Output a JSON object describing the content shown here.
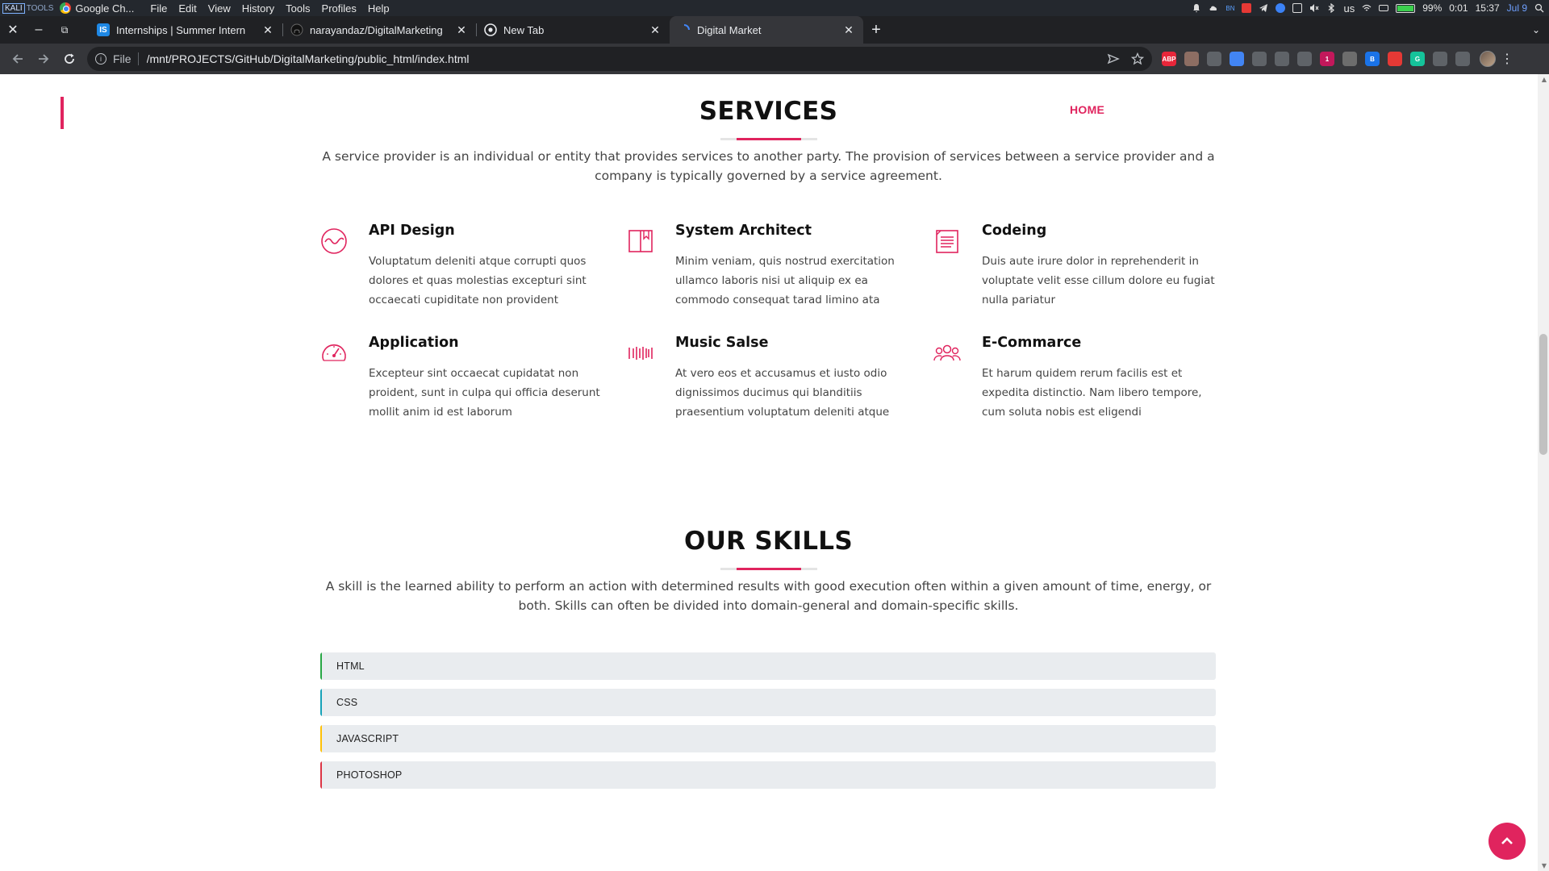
{
  "system_panel": {
    "kali_box": "KALI",
    "kali_tools": "TOOLS",
    "app_name": "Google Ch...",
    "menu": [
      "File",
      "Edit",
      "View",
      "History",
      "Tools",
      "Profiles",
      "Help"
    ],
    "tray_locale": "us",
    "tray_bn": "BN",
    "battery_text": "99%",
    "battery_level": 0.99,
    "uptime": "0:01",
    "clock": "15:37",
    "date": "Jul 9"
  },
  "tabs": [
    {
      "label": "Internships | Summer Intern",
      "favicon": "IS",
      "favicon_color": "#1e88e5",
      "active": false
    },
    {
      "label": "narayandaz/DigitalMarketing",
      "favicon": "github-icon",
      "favicon_color": "#24292e",
      "active": false
    },
    {
      "label": "New Tab",
      "favicon": "chrome-icon",
      "favicon_color": "#5f6368",
      "active": false
    },
    {
      "label": "Digital Market",
      "favicon": "loading-icon",
      "favicon_color": "#4285f4",
      "active": true
    }
  ],
  "toolbar": {
    "scheme": "File",
    "url": "/mnt/PROJECTS/GitHub/DigitalMarketing/public_html/index.html"
  },
  "extensions": [
    {
      "name": "adblock-plus-icon",
      "text": "ABP",
      "color": "#e8263a"
    },
    {
      "name": "extension-owl-icon",
      "text": "",
      "color": "#8d6e63"
    },
    {
      "name": "extension-print-icon",
      "text": "",
      "color": "#5f6368"
    },
    {
      "name": "google-translate-icon",
      "text": "",
      "color": "#4285f4"
    },
    {
      "name": "extension-pen-icon",
      "text": "",
      "color": "#5f6368"
    },
    {
      "name": "extension-screen-icon",
      "text": "",
      "color": "#5f6368"
    },
    {
      "name": "extension-page-icon",
      "text": "",
      "color": "#5f6368"
    },
    {
      "name": "extension-badge-icon",
      "text": "1",
      "color": "#c2185b"
    },
    {
      "name": "extension-pdf-icon",
      "text": "",
      "color": "#6d6d6d"
    },
    {
      "name": "extension-b-icon",
      "text": "B",
      "color": "#1a73e8"
    },
    {
      "name": "extension-cards-icon",
      "text": "",
      "color": "#e53935"
    },
    {
      "name": "grammarly-icon",
      "text": "G",
      "color": "#15c39a"
    },
    {
      "name": "extensions-puzzle-icon",
      "text": "",
      "color": "#5f6368"
    },
    {
      "name": "side-panel-icon",
      "text": "",
      "color": "#5f6368"
    }
  ],
  "nav": {
    "home_label": "HOME"
  },
  "services": {
    "title": "SERVICES",
    "description": "A service provider is an individual or entity that provides services to another party. The provision of services between a service provider and a company is typically governed by a service agreement.",
    "items": [
      {
        "title": "API Design",
        "text": "Voluptatum deleniti atque corrupti quos dolores et quas molestias excepturi sint occaecati cupiditate non provident",
        "icon": "wave-circle-icon"
      },
      {
        "title": "System Architect",
        "text": "Minim veniam, quis nostrud exercitation ullamco laboris nisi ut aliquip ex ea commodo consequat tarad limino ata",
        "icon": "book-icon"
      },
      {
        "title": "Codeing",
        "text": "Duis aute irure dolor in reprehenderit in voluptate velit esse cillum dolore eu fugiat nulla pariatur",
        "icon": "document-lines-icon"
      },
      {
        "title": "Application",
        "text": "Excepteur sint occaecat cupidatat non proident, sunt in culpa qui officia deserunt mollit anim id est laborum",
        "icon": "speedometer-icon"
      },
      {
        "title": "Music Salse",
        "text": "At vero eos et accusamus et iusto odio dignissimos ducimus qui blanditiis praesentium voluptatum deleniti atque",
        "icon": "barcode-icon"
      },
      {
        "title": "E-Commarce",
        "text": "Et harum quidem rerum facilis est et expedita distinctio. Nam libero tempore, cum soluta nobis est eligendi",
        "icon": "people-icon"
      }
    ]
  },
  "skills": {
    "title": "OUR SKILLS",
    "description": "A skill is the learned ability to perform an action with determined results with good execution often within a given amount of time, energy, or both. Skills can often be divided into domain-general and domain-specific skills.",
    "items": [
      {
        "label": "HTML",
        "color": "#28a745"
      },
      {
        "label": "CSS",
        "color": "#17a2b8"
      },
      {
        "label": "JAVASCRIPT",
        "color": "#ffc107"
      },
      {
        "label": "PHOTOSHOP",
        "color": "#dc3545"
      }
    ]
  },
  "colors": {
    "accent": "#e0245e"
  }
}
